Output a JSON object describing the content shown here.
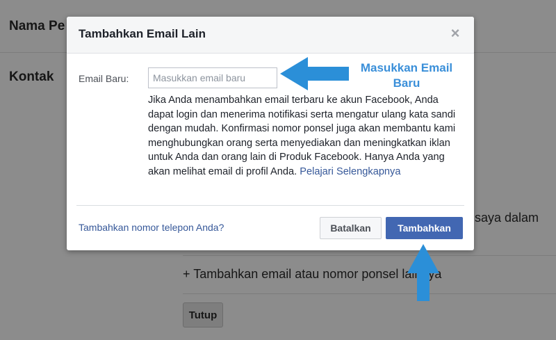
{
  "background": {
    "section_name_label": "Nama Pe",
    "section_contact_label": "Kontak",
    "right_partial_text": "saya dalam",
    "add_contact_text": "+ Tambahkan email atau nomor ponsel lainnya",
    "close_button_label": "Tutup"
  },
  "dialog": {
    "title": "Tambahkan Email Lain",
    "close_icon": "×",
    "email_label": "Email Baru:",
    "email_placeholder": "Masukkan email baru",
    "email_value": "",
    "description": "Jika Anda menambahkan email terbaru ke akun Facebook, Anda dapat login dan menerima notifikasi serta mengatur ulang kata sandi dengan mudah. Konfirmasi nomor ponsel juga akan membantu kami menghubungkan orang serta menyediakan dan meningkatkan iklan untuk Anda dan orang lain di Produk Facebook. Hanya Anda yang akan melihat email di profil Anda.",
    "learn_more_link": "Pelajari Selengkapnya",
    "add_phone_link": "Tambahkan nomor telepon Anda?",
    "cancel_button": "Batalkan",
    "submit_button": "Tambahkan"
  },
  "annotations": {
    "callout_line1": "Masukkan Email",
    "callout_line2": "Baru",
    "arrow_color": "#2b8fd8"
  },
  "colors": {
    "primary_button": "#4267b2",
    "link": "#365899",
    "overlay": "#8c8c8c"
  }
}
